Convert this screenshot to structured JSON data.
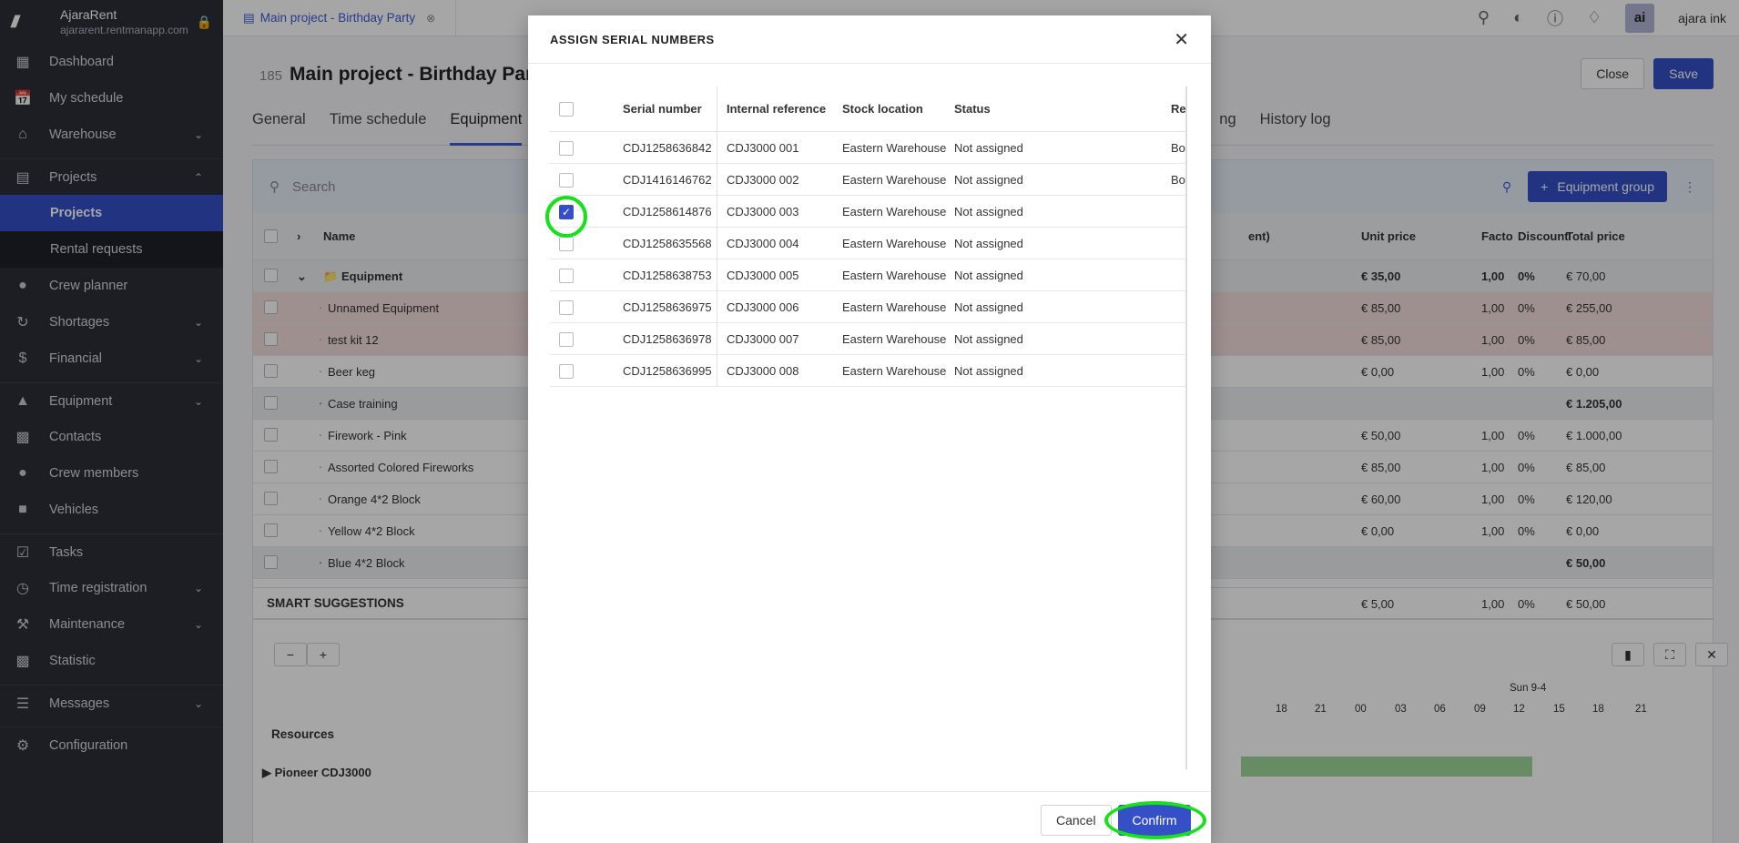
{
  "brand": {
    "logo": "///",
    "name": "AjaraRent",
    "domain": "ajararent.rentmanapp.com"
  },
  "sidebar": {
    "items": [
      {
        "label": "Dashboard",
        "icon": "dashboard-icon"
      },
      {
        "label": "My schedule",
        "icon": "calendar-icon"
      },
      {
        "label": "Warehouse",
        "icon": "warehouse-icon"
      },
      {
        "label": "Projects",
        "icon": "projects-icon"
      },
      {
        "label": "Projects"
      },
      {
        "label": "Rental requests"
      },
      {
        "label": "Crew planner",
        "icon": "person-icon"
      },
      {
        "label": "Shortages",
        "icon": "shortages-icon"
      },
      {
        "label": "Financial",
        "icon": "dollar-icon"
      },
      {
        "label": "Equipment",
        "icon": "equipment-icon"
      },
      {
        "label": "Contacts",
        "icon": "contacts-icon"
      },
      {
        "label": "Crew members",
        "icon": "crew-icon"
      },
      {
        "label": "Vehicles",
        "icon": "truck-icon"
      },
      {
        "label": "Tasks",
        "icon": "tasks-icon"
      },
      {
        "label": "Time registration",
        "icon": "clock-icon"
      },
      {
        "label": "Maintenance",
        "icon": "wrench-icon"
      },
      {
        "label": "Statistic",
        "icon": "chart-icon"
      },
      {
        "label": "Messages",
        "icon": "messages-icon"
      },
      {
        "label": "Configuration",
        "icon": "gear-icon"
      }
    ]
  },
  "topbar": {
    "doc_tab": "Main project - Birthday Party",
    "user_initials": "ai",
    "user_name": "ajara ink"
  },
  "page": {
    "number": "185",
    "title": "Main project - Birthday Party",
    "close": "Close",
    "save": "Save",
    "tabs": [
      "General",
      "Time schedule",
      "Equipment",
      "ng",
      "History log"
    ],
    "search_placeholder": "Search",
    "equipment_group": "Equipment group"
  },
  "table": {
    "headers": {
      "name": "Name",
      "frag": "ent)",
      "unit": "Unit price",
      "factor": "Facto",
      "discount": "Discount",
      "total": "Total price"
    },
    "rows": [
      {
        "name": "Equipment",
        "unit": "€ 35,00",
        "factor": "1,00",
        "discount": "0%",
        "total": "€ 70,00",
        "kind": "grp"
      },
      {
        "name": "Unnamed Equipment",
        "unit": "€ 85,00",
        "factor": "1,00",
        "discount": "0%",
        "total": "€ 255,00",
        "kind": "red"
      },
      {
        "name": "test kit 12",
        "unit": "€ 85,00",
        "factor": "1,00",
        "discount": "0%",
        "total": "€ 85,00",
        "kind": "red"
      },
      {
        "name": "Beer keg",
        "unit": "€ 0,00",
        "factor": "1,00",
        "discount": "0%",
        "total": "€ 0,00",
        "kind": ""
      },
      {
        "name": "Case training",
        "unit": "",
        "factor": "",
        "discount": "",
        "total": "€ 1.205,00",
        "kind": "grp2"
      },
      {
        "name": "Firework - Pink",
        "unit": "€ 50,00",
        "factor": "1,00",
        "discount": "0%",
        "total": "€ 1.000,00",
        "kind": ""
      },
      {
        "name": "Assorted Colored Fireworks",
        "unit": "€ 85,00",
        "factor": "1,00",
        "discount": "0%",
        "total": "€ 85,00",
        "kind": ""
      },
      {
        "name": "Orange 4*2 Block",
        "unit": "€ 60,00",
        "factor": "1,00",
        "discount": "0%",
        "total": "€ 120,00",
        "kind": ""
      },
      {
        "name": "Yellow 4*2 Block",
        "unit": "€ 0,00",
        "factor": "1,00",
        "discount": "0%",
        "total": "€ 0,00",
        "kind": ""
      },
      {
        "name": "Blue 4*2 Block",
        "unit": "",
        "factor": "",
        "discount": "",
        "total": "€ 50,00",
        "kind": "grp2"
      }
    ],
    "smart": {
      "label": "SMART SUGGESTIONS",
      "unit": "€ 5,00",
      "factor": "1,00",
      "discount": "0%",
      "total": "€ 50,00"
    }
  },
  "planner": {
    "resources": "Resources",
    "resource_row": "Pioneer CDJ3000",
    "day_label": "Sun 9-4",
    "hours": [
      "18",
      "21",
      "00",
      "03",
      "06",
      "09",
      "12",
      "15",
      "18",
      "21"
    ]
  },
  "modal": {
    "title": "ASSIGN SERIAL NUMBERS",
    "headers": {
      "serial": "Serial number",
      "ref": "Internal reference",
      "loc": "Stock location",
      "status": "Status",
      "rem": "Rem"
    },
    "rows": [
      {
        "serial": "CDJ1258636842",
        "ref": "CDJ3000 001",
        "loc": "Eastern Warehouse",
        "status": "Not assigned",
        "rem": "Bou",
        "checked": false
      },
      {
        "serial": "CDJ1416146762",
        "ref": "CDJ3000 002",
        "loc": "Eastern Warehouse",
        "status": "Not assigned",
        "rem": "Bou",
        "checked": false
      },
      {
        "serial": "CDJ1258614876",
        "ref": "CDJ3000 003",
        "loc": "Eastern Warehouse",
        "status": "Not assigned",
        "rem": "",
        "checked": true
      },
      {
        "serial": "CDJ1258635568",
        "ref": "CDJ3000 004",
        "loc": "Eastern Warehouse",
        "status": "Not assigned",
        "rem": "",
        "checked": false
      },
      {
        "serial": "CDJ1258638753",
        "ref": "CDJ3000 005",
        "loc": "Eastern Warehouse",
        "status": "Not assigned",
        "rem": "",
        "checked": false
      },
      {
        "serial": "CDJ1258636975",
        "ref": "CDJ3000 006",
        "loc": "Eastern Warehouse",
        "status": "Not assigned",
        "rem": "",
        "checked": false
      },
      {
        "serial": "CDJ1258636978",
        "ref": "CDJ3000 007",
        "loc": "Eastern Warehouse",
        "status": "Not assigned",
        "rem": "",
        "checked": false
      },
      {
        "serial": "CDJ1258636995",
        "ref": "CDJ3000 008",
        "loc": "Eastern Warehouse",
        "status": "Not assigned",
        "rem": "",
        "checked": false
      }
    ],
    "cancel": "Cancel",
    "confirm": "Confirm"
  },
  "colors": {
    "accent": "#3550c6",
    "highlight_ring": "#16e21a",
    "sidebar_bg": "#2c2f38"
  }
}
